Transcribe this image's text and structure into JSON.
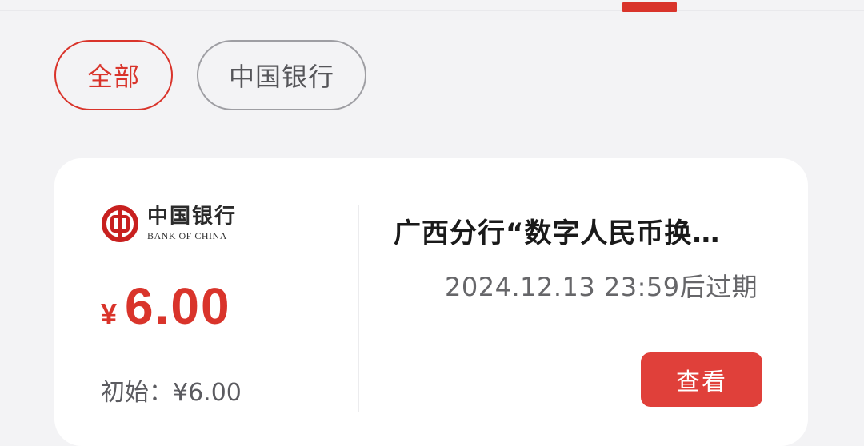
{
  "filters": [
    {
      "label": "全部",
      "active": true
    },
    {
      "label": "中国银行",
      "active": false
    }
  ],
  "coupon": {
    "bank_logo": {
      "icon": "bank-of-china-logo",
      "name_cn": "中国银行",
      "name_en": "BANK OF CHINA"
    },
    "currency_symbol": "¥",
    "amount": "6.00",
    "initial_text": "初始：¥6.00",
    "title": "广西分行“数字人民币换…",
    "expiry_text": "2024.12.13 23:59后过期",
    "view_button_label": "查看"
  },
  "colors": {
    "accent_red": "#d9342b",
    "button_red": "#e0403a",
    "background": "#f3f3f5",
    "card": "#ffffff"
  }
}
